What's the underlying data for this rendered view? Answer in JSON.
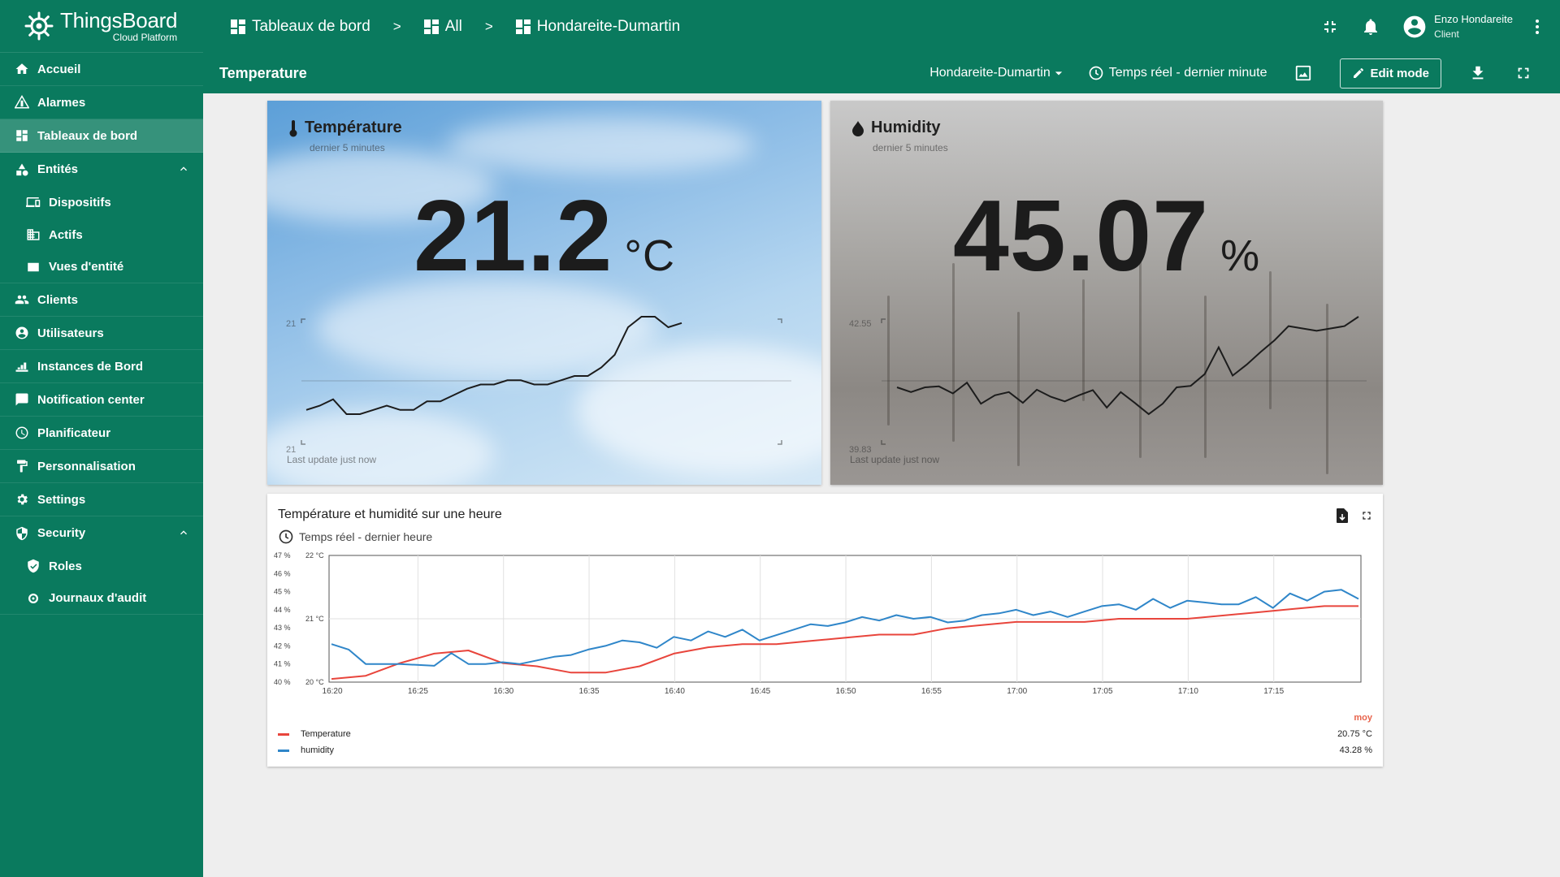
{
  "brand": {
    "name": "ThingsBoard",
    "tagline": "Cloud Platform"
  },
  "sidebar": {
    "items": [
      {
        "label": "Accueil",
        "icon": "home-icon"
      },
      {
        "label": "Alarmes",
        "icon": "alarm-warning-icon"
      },
      {
        "label": "Tableaux de bord",
        "icon": "dashboard-icon",
        "active": true
      },
      {
        "label": "Entités",
        "icon": "entities-icon",
        "expanded": true
      },
      {
        "label": "Dispositifs",
        "icon": "devices-icon",
        "sub": true
      },
      {
        "label": "Actifs",
        "icon": "assets-icon",
        "sub": true
      },
      {
        "label": "Vues d'entité",
        "icon": "entity-views-icon",
        "sub": true
      },
      {
        "label": "Clients",
        "icon": "clients-icon"
      },
      {
        "label": "Utilisateurs",
        "icon": "users-icon"
      },
      {
        "label": "Instances de Bord",
        "icon": "edge-instances-icon"
      },
      {
        "label": "Notification center",
        "icon": "notification-center-icon"
      },
      {
        "label": "Planificateur",
        "icon": "scheduler-icon"
      },
      {
        "label": "Personnalisation",
        "icon": "white-labeling-icon"
      },
      {
        "label": "Settings",
        "icon": "settings-icon"
      },
      {
        "label": "Security",
        "icon": "security-icon",
        "expanded": true
      },
      {
        "label": "Roles",
        "icon": "roles-icon",
        "sub": true
      },
      {
        "label": "Journaux d'audit",
        "icon": "audit-logs-icon",
        "sub": true
      }
    ]
  },
  "topbar": {
    "breadcrumb": [
      "Tableaux de bord",
      "All",
      "Hondareite-Dumartin"
    ],
    "separator": ">",
    "user": {
      "name": "Enzo Hondareite",
      "role": "Client"
    }
  },
  "toolbar": {
    "title": "Temperature",
    "entity": "Hondareite-Dumartin",
    "timewindow": "Temps réel - dernier minute",
    "edit_label": "Edit mode"
  },
  "temp_card": {
    "title": "Température",
    "subtitle": "dernier 5 minutes",
    "value": "21.2",
    "unit": "°C",
    "axis_max": "21",
    "axis_min": "21",
    "last_update": "Last update just now",
    "spark": [
      20.96,
      20.98,
      21.01,
      20.94,
      20.94,
      20.96,
      20.98,
      20.96,
      20.96,
      21.0,
      21.0,
      21.03,
      21.06,
      21.08,
      21.08,
      21.1,
      21.1,
      21.08,
      21.08,
      21.1,
      21.12,
      21.12,
      21.16,
      21.22,
      21.35,
      21.4,
      21.4,
      21.35,
      21.37
    ]
  },
  "hum_card": {
    "title": "Humidity",
    "subtitle": "dernier 5 minutes",
    "value": "45.07",
    "unit": "%",
    "axis_max": "42.55",
    "axis_min": "39.83",
    "last_update": "Last update just now",
    "spark": [
      41.05,
      40.95,
      41.05,
      41.07,
      40.92,
      41.15,
      40.7,
      40.88,
      40.95,
      40.72,
      41.0,
      40.85,
      40.75,
      40.88,
      40.99,
      40.62,
      40.95,
      40.72,
      40.48,
      40.7,
      41.05,
      41.08,
      41.33,
      41.9,
      41.3,
      41.53,
      41.8,
      42.05,
      42.35,
      42.3,
      42.25,
      42.3,
      42.35,
      42.55
    ]
  },
  "chart": {
    "title": "Température et humidité sur une heure",
    "timewindow": "Temps réel - dernier heure",
    "legend_header": "moy",
    "legend": [
      {
        "name": "Temperature",
        "value": "20.75 °C",
        "color": "#e8453c"
      },
      {
        "name": "humidity",
        "value": "43.28 %",
        "color": "#2f86c9"
      }
    ]
  },
  "chart_data": {
    "type": "line",
    "x_ticks": [
      "16:20",
      "16:25",
      "16:30",
      "16:35",
      "16:40",
      "16:45",
      "16:50",
      "16:55",
      "17:00",
      "17:05",
      "17:10",
      "17:15"
    ],
    "y_left_ticks": [
      "47 %",
      "46 %",
      "45 %",
      "44 %",
      "43 %",
      "42 %",
      "41 %",
      "40 %"
    ],
    "y_right_ticks": [
      "22 °C",
      "21 °C",
      "20 °C"
    ],
    "ylim_humidity": [
      40,
      47
    ],
    "ylim_temperature": [
      20,
      22
    ],
    "xlim_minutes": [
      0,
      60
    ],
    "series": [
      {
        "name": "Temperature",
        "color": "#e8453c",
        "x": [
          0,
          2,
          4,
          6,
          8,
          10,
          12,
          14,
          16,
          18,
          20,
          22,
          24,
          26,
          28,
          30,
          32,
          34,
          36,
          38,
          40,
          42,
          44,
          46,
          48,
          50,
          52,
          54,
          56,
          58,
          60
        ],
        "values": [
          20.05,
          20.1,
          20.3,
          20.45,
          20.5,
          20.3,
          20.25,
          20.15,
          20.15,
          20.25,
          20.45,
          20.55,
          20.6,
          20.6,
          20.65,
          20.7,
          20.75,
          20.75,
          20.85,
          20.9,
          20.95,
          20.95,
          20.95,
          21.0,
          21.0,
          21.0,
          21.05,
          21.1,
          21.15,
          21.2,
          21.2
        ]
      },
      {
        "name": "humidity",
        "color": "#2f86c9",
        "x": [
          0,
          1,
          2,
          3,
          4,
          5,
          6,
          7,
          8,
          9,
          10,
          11,
          12,
          13,
          14,
          15,
          16,
          17,
          18,
          19,
          20,
          21,
          22,
          23,
          24,
          25,
          26,
          27,
          28,
          29,
          30,
          31,
          32,
          33,
          34,
          35,
          36,
          37,
          38,
          39,
          40,
          41,
          42,
          43,
          44,
          45,
          46,
          47,
          48,
          49,
          50,
          51,
          52,
          53,
          54,
          55,
          56,
          57,
          58,
          59,
          60
        ],
        "values": [
          42.1,
          41.8,
          41.0,
          41.0,
          41.0,
          40.95,
          40.9,
          41.6,
          41.0,
          41.0,
          41.1,
          41.0,
          41.2,
          41.4,
          41.5,
          41.8,
          42.0,
          42.3,
          42.2,
          41.9,
          42.5,
          42.3,
          42.8,
          42.5,
          42.9,
          42.3,
          42.6,
          42.9,
          43.2,
          43.1,
          43.3,
          43.6,
          43.4,
          43.7,
          43.5,
          43.6,
          43.3,
          43.4,
          43.7,
          43.8,
          44.0,
          43.7,
          43.9,
          43.6,
          43.9,
          44.2,
          44.3,
          44.0,
          44.6,
          44.1,
          44.5,
          44.4,
          44.3,
          44.3,
          44.7,
          44.1,
          44.9,
          44.5,
          45.0,
          45.1,
          44.6
        ]
      }
    ]
  }
}
